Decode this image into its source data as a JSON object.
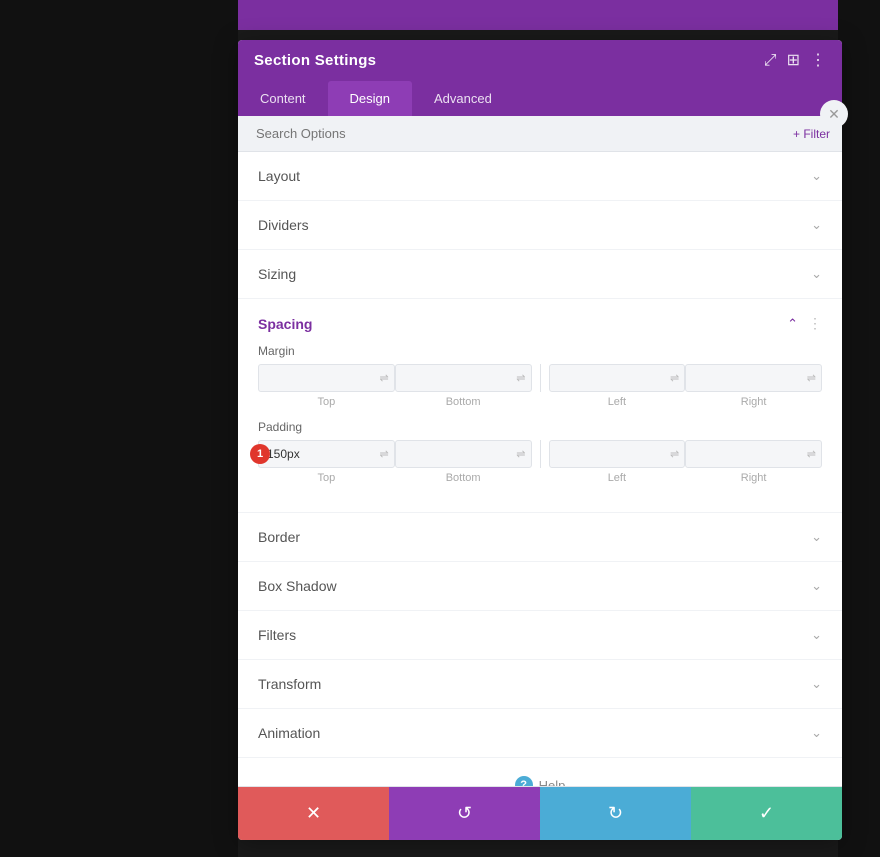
{
  "background": {
    "left_color": "#111111",
    "right_color": "#111111",
    "purple_bar": "#7b2fa0"
  },
  "panel": {
    "title": "Section Settings",
    "header_icons": {
      "expand": "⤢",
      "columns": "⊞",
      "more": "⋮"
    },
    "tabs": [
      {
        "id": "content",
        "label": "Content",
        "active": false
      },
      {
        "id": "design",
        "label": "Design",
        "active": true
      },
      {
        "id": "advanced",
        "label": "Advanced",
        "active": false
      }
    ],
    "search": {
      "placeholder": "Search Options"
    },
    "filter_label": "+ Filter",
    "sections": [
      {
        "id": "layout",
        "label": "Layout",
        "expanded": false
      },
      {
        "id": "dividers",
        "label": "Dividers",
        "expanded": false
      },
      {
        "id": "sizing",
        "label": "Sizing",
        "expanded": false
      },
      {
        "id": "spacing",
        "label": "Spacing",
        "expanded": true
      },
      {
        "id": "border",
        "label": "Border",
        "expanded": false
      },
      {
        "id": "box-shadow",
        "label": "Box Shadow",
        "expanded": false
      },
      {
        "id": "filters",
        "label": "Filters",
        "expanded": false
      },
      {
        "id": "transform",
        "label": "Transform",
        "expanded": false
      },
      {
        "id": "animation",
        "label": "Animation",
        "expanded": false
      }
    ],
    "spacing": {
      "section_label": "Spacing",
      "margin": {
        "label": "Margin",
        "top_value": "",
        "bottom_value": "",
        "left_value": "",
        "right_value": "",
        "top_label": "Top",
        "bottom_label": "Bottom",
        "left_label": "Left",
        "right_label": "Right"
      },
      "padding": {
        "label": "Padding",
        "badge": "1",
        "top_value": "150px",
        "bottom_value": "",
        "left_value": "",
        "right_value": "",
        "top_label": "Top",
        "bottom_label": "Bottom",
        "left_label": "Left",
        "right_label": "Right"
      }
    },
    "help_label": "Help",
    "footer": {
      "cancel_icon": "✕",
      "undo_icon": "↺",
      "redo_icon": "↻",
      "save_icon": "✓"
    }
  }
}
